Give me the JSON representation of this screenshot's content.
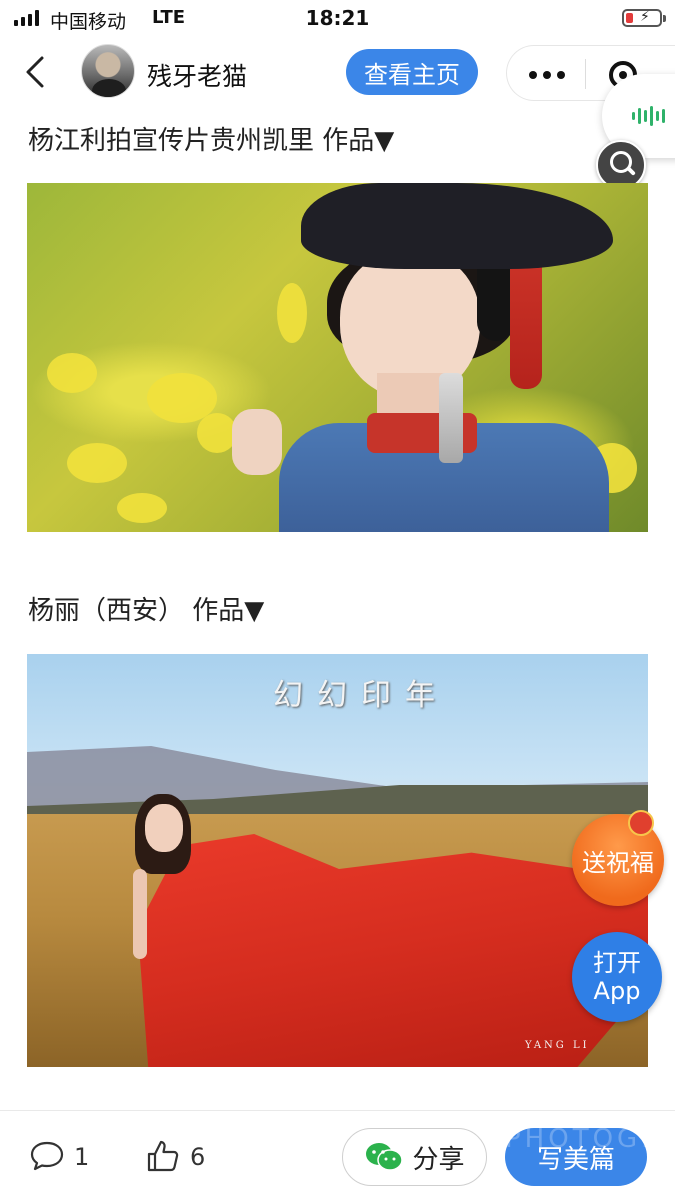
{
  "status_bar": {
    "carrier": "中国移动",
    "network": "LTE",
    "time": "18:21",
    "icons": [
      "signal-icon",
      "battery-charging-icon"
    ]
  },
  "nav": {
    "author_name": "残牙老猫",
    "view_home_label": "查看主页",
    "icons": [
      "back-icon",
      "more-icon",
      "mini-program-close-icon",
      "voice-icon",
      "search-icon"
    ]
  },
  "posts": [
    {
      "caption": "杨江利拍宣传片贵州凯里 作品▼"
    },
    {
      "caption": "杨丽（西安） 作品▼",
      "photo_title": "幻幻印年",
      "photo_signature": "YANG LI"
    }
  ],
  "floating": {
    "blessing_label": "送祝福",
    "open_app_line1": "打开",
    "open_app_line2": "App"
  },
  "bottom_bar": {
    "comment_count": "1",
    "like_count": "6",
    "share_label": "分享",
    "write_label": "写美篇",
    "watermark": "PHOTOGRA"
  },
  "colors": {
    "accent_blue": "#3b86e8",
    "blessing_orange": "#f06a1c",
    "voice_green": "#2fb26a"
  }
}
